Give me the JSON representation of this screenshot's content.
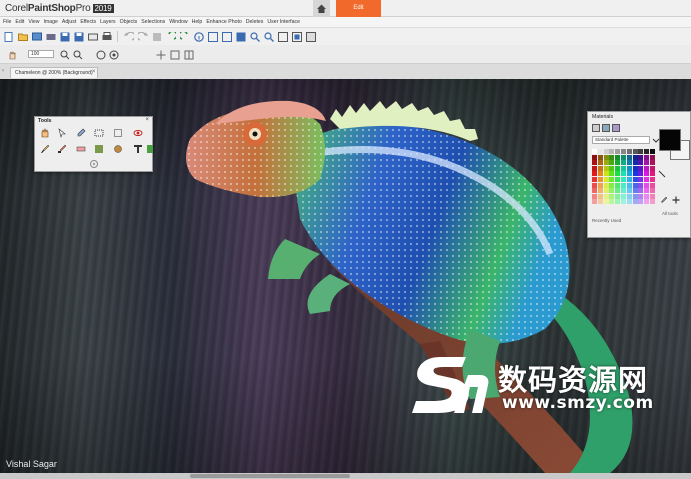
{
  "app": {
    "title_brand": "Corel",
    "title_product": "PaintShop",
    "title_suffix": "Pro",
    "title_year": "2019",
    "edit_tab": "Edit"
  },
  "menu": [
    "File",
    "Edit",
    "View",
    "Image",
    "Adjust",
    "Effects",
    "Layers",
    "Objects",
    "Selections",
    "Window",
    "Help",
    "Enhance Photo",
    "Deletes",
    "User Interface"
  ],
  "toolbar2": {
    "zoom_value": "100"
  },
  "document": {
    "tab_label": "Chameleon @ 200% (Background)"
  },
  "canvas": {
    "photo_credit": "Vishal Sagar"
  },
  "tools_palette": {
    "title": "Tools"
  },
  "materials_palette": {
    "title": "Materials",
    "palette_select": "Standard Palette",
    "recently_used": "Recently Used",
    "all_tools_label": "All tools"
  },
  "watermark": {
    "text_cn": "数码资源网",
    "url": "www.smzy.com"
  },
  "colors": {
    "accent": "#f26a2b",
    "foreground": "#050505",
    "background": "#f4f4f4"
  },
  "icons": [
    "home-icon",
    "new-icon",
    "open-icon",
    "save-icon",
    "print-icon",
    "undo-icon",
    "redo-icon",
    "zoom-in-icon",
    "zoom-out-icon",
    "pan-icon",
    "selection-icon",
    "dropper-icon",
    "brush-icon",
    "text-icon",
    "close-icon"
  ]
}
